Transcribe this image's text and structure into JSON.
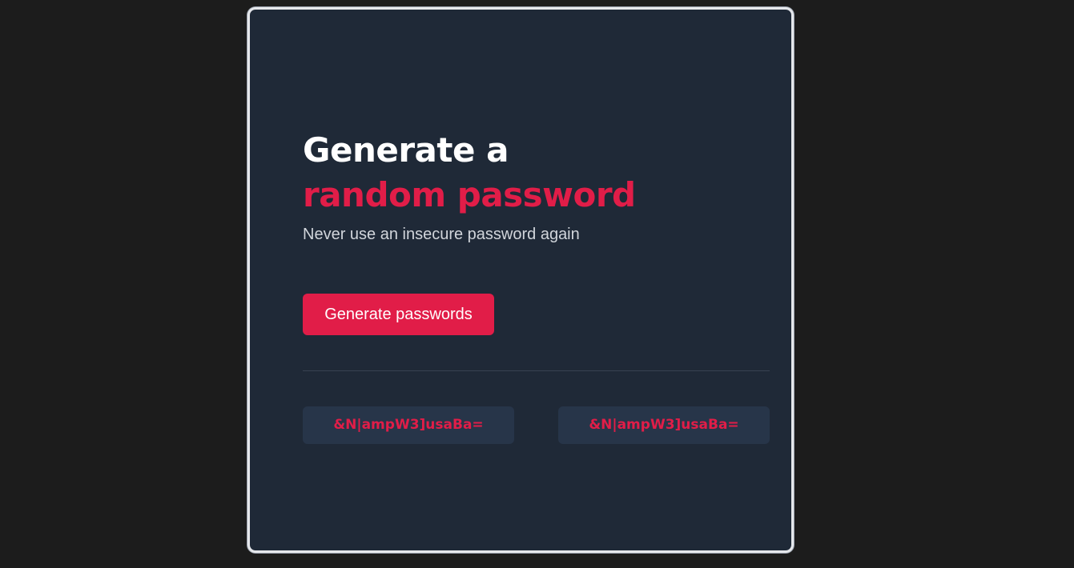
{
  "hero": {
    "title_line1": "Generate a",
    "title_line2": "random password",
    "subtitle": "Never use an insecure password again"
  },
  "actions": {
    "generate_label": "Generate passwords"
  },
  "passwords": [
    "&N|ampW3]usaBa=",
    "&N|ampW3]usaBa="
  ],
  "colors": {
    "page_background": "#1c1c1c",
    "card_background": "#1f2937",
    "accent": "#e11d48",
    "password_box": "#273549"
  }
}
